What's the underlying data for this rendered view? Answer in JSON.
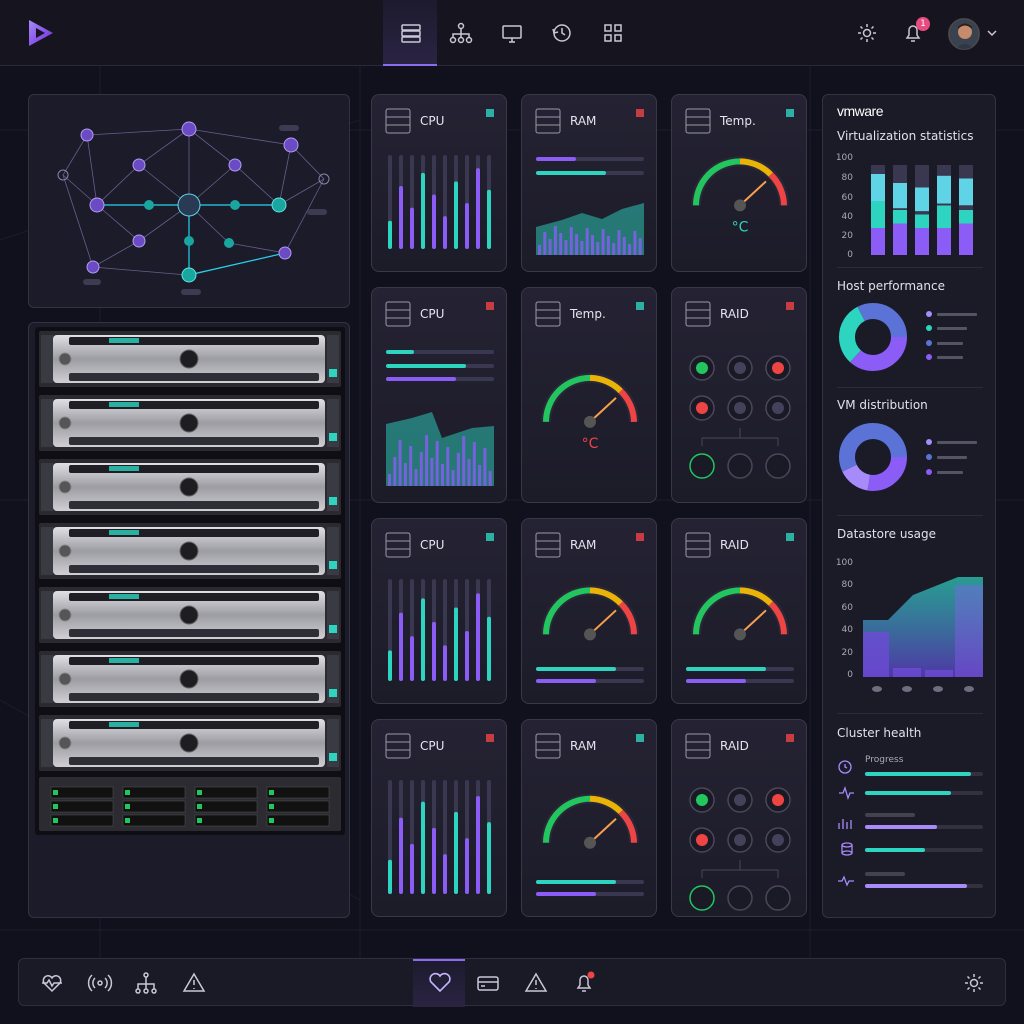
{
  "header": {
    "nav": [
      "servers-icon",
      "network-icon",
      "monitor-icon",
      "history-icon",
      "apps-icon"
    ],
    "notification_count": "1"
  },
  "cards": [
    {
      "title": "CPU",
      "type": "bars-vertical"
    },
    {
      "title": "RAM",
      "type": "area"
    },
    {
      "title": "Temp.",
      "type": "gauge",
      "unit": "°C"
    },
    {
      "title": "CPU",
      "type": "hbars-area"
    },
    {
      "title": "Temp.",
      "type": "gauge",
      "unit": "°C"
    },
    {
      "title": "RAID",
      "type": "raid"
    },
    {
      "title": "CPU",
      "type": "bars-vertical"
    },
    {
      "title": "RAM",
      "type": "gauge"
    },
    {
      "title": "RAID",
      "type": "gauge"
    },
    {
      "title": "CPU",
      "type": "bars-vertical"
    },
    {
      "title": "RAM",
      "type": "gauge"
    },
    {
      "title": "RAID",
      "type": "raid"
    }
  ],
  "sidebar": {
    "brand": "vmware",
    "virtualization_title": "Virtualization statistics",
    "virtualization_axis": [
      "100",
      "80",
      "60",
      "40",
      "20",
      "0"
    ],
    "host_title": "Host performance",
    "vm_title": "VM distribution",
    "datastore_title": "Datastore usage",
    "datastore_axis": [
      "100",
      "80",
      "60",
      "40",
      "20",
      "0"
    ],
    "cluster_title": "Cluster health",
    "cluster_progress_label": "Progress"
  },
  "colors": {
    "purple": "#8b5cf6",
    "teal": "#2dd4bf",
    "green": "#22c55e",
    "red": "#ef4444",
    "orange": "#f97316"
  },
  "bottom_nav": [
    "heartbeat-icon",
    "broadcast-icon",
    "hierarchy-icon",
    "warning-icon",
    "heart-icon",
    "storage-icon",
    "alert-icon",
    "bell-icon",
    "settings-icon"
  ]
}
